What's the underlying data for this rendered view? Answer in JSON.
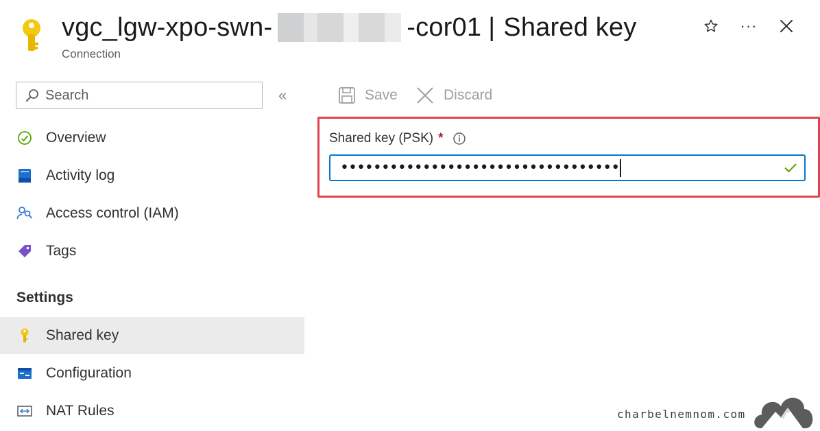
{
  "header": {
    "title_prefix": "vgc_lgw-xpo-swn-",
    "title_suffix": "-cor01",
    "separator": "|",
    "page_name": "Shared key",
    "subtitle": "Connection",
    "star_label": "☆",
    "more_label": "···",
    "close_label": "✕"
  },
  "sidebar": {
    "search_placeholder": "Search",
    "collapse_label": "«",
    "items": [
      {
        "label": "Overview",
        "icon": "overview-icon"
      },
      {
        "label": "Activity log",
        "icon": "activity-log-icon"
      },
      {
        "label": "Access control (IAM)",
        "icon": "iam-icon"
      },
      {
        "label": "Tags",
        "icon": "tag-icon"
      }
    ],
    "section_settings": "Settings",
    "settings_items": [
      {
        "label": "Shared key",
        "icon": "key-icon",
        "active": true
      },
      {
        "label": "Configuration",
        "icon": "configuration-icon"
      },
      {
        "label": "NAT Rules",
        "icon": "nat-rules-icon"
      }
    ]
  },
  "toolbar": {
    "save_label": "Save",
    "discard_label": "Discard"
  },
  "form": {
    "psk_label": "Shared key (PSK)",
    "required_mark": "*",
    "psk_value_masked": "••••••••••••••••••••••••••••••••••"
  },
  "watermark": {
    "text": "charbelnemnom.com"
  },
  "colors": {
    "accent": "#0078d4",
    "highlight_border": "#e0434c",
    "key_yellow": "#f2c811",
    "valid_green": "#57a300"
  }
}
